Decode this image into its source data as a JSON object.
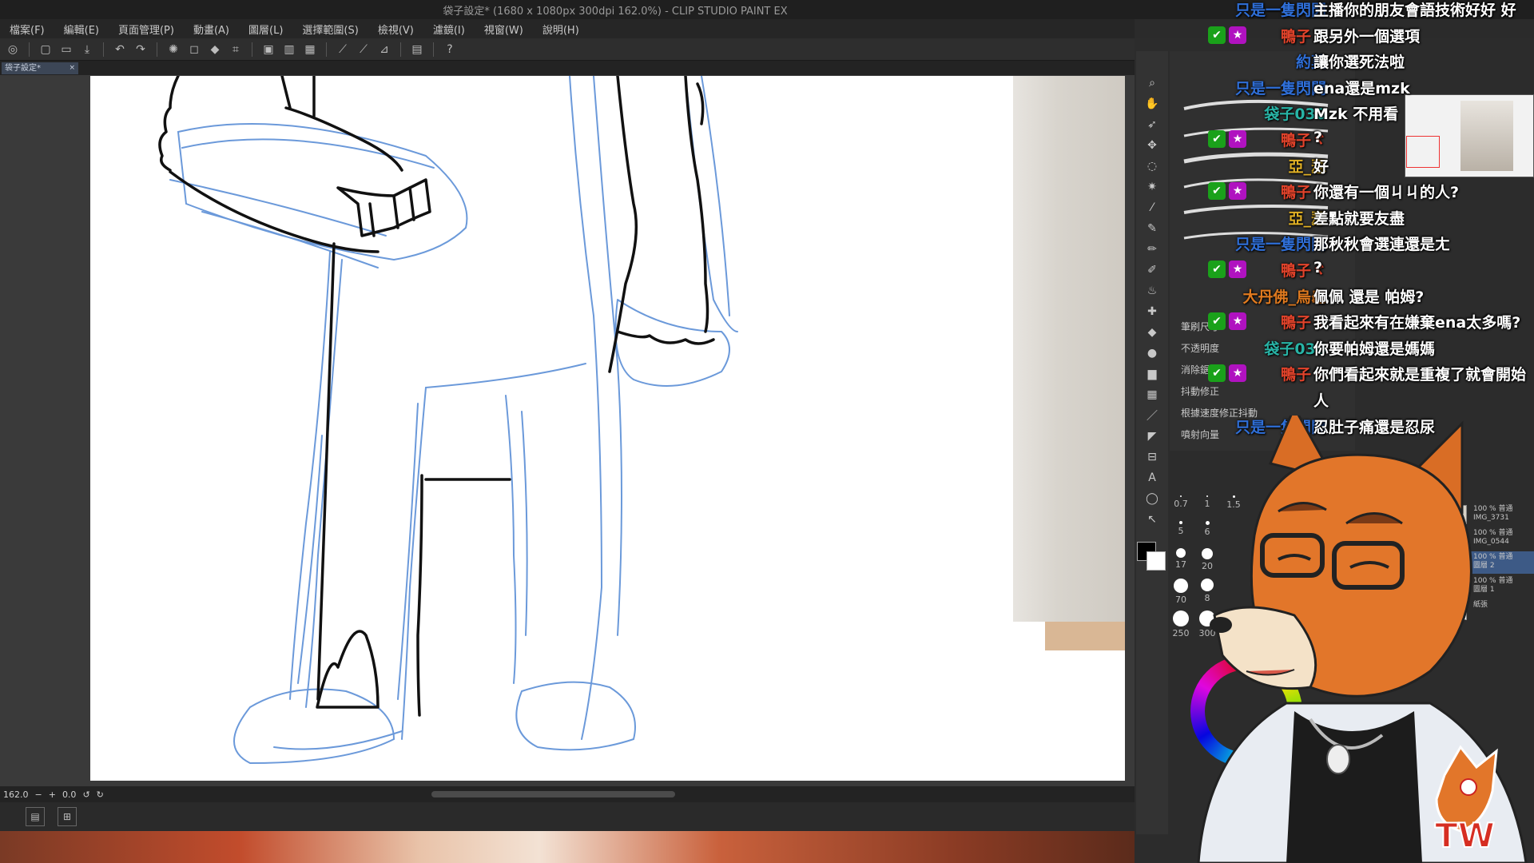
{
  "window": {
    "title": "袋子設定* (1680 x 1080px 300dpi 162.0%) - CLIP STUDIO PAINT EX"
  },
  "menu": [
    "檔案(F)",
    "編輯(E)",
    "頁面管理(P)",
    "動畫(A)",
    "圖層(L)",
    "選擇範圍(S)",
    "檢視(V)",
    "濾鏡(I)",
    "視窗(W)",
    "說明(H)"
  ],
  "doc_tab": {
    "label": "袋子設定*",
    "close": "×"
  },
  "status": {
    "zoom": "162.0",
    "angle": "0.0"
  },
  "properties": {
    "labels": [
      "筆刷尺寸",
      "不透明度",
      "消除鋸齒",
      "抖動修正",
      "根據速度修正抖動",
      "噴射向量"
    ],
    "zoom_small": "162.0"
  },
  "brush_sizes": [
    "0.7",
    "1",
    "1.5",
    "5",
    "6",
    "17",
    "20",
    "70",
    "8",
    "250",
    "300"
  ],
  "layers": [
    {
      "line1": "100 % 普通",
      "line2": "IMG_3731"
    },
    {
      "line1": "100 % 普通",
      "line2": "IMG_0544"
    },
    {
      "line1": "100 % 普通",
      "line2": "圖層 2"
    },
    {
      "line1": "100 % 普通",
      "line2": "圖層 1"
    },
    {
      "line1": "",
      "line2": "紙張"
    }
  ],
  "colors": {
    "mod_badge": "#1aa11a",
    "vip_badge": "#b012c0",
    "sketch_blue": "#5b8fd6",
    "ink": "#111111",
    "user_red": "#e2432b",
    "user_yellow": "#e0b025",
    "user_blue": "#2f6fd8",
    "user_teal": "#28b4a6",
    "user_orange": "#e07a1f"
  },
  "chat": [
    {
      "user": "只是一隻閃閃",
      "color": "#2f6fd8",
      "badges": [],
      "text": "主播你的朋友會語技術好好 好"
    },
    {
      "user": "鴨子ヾ",
      "color": "#e2432b",
      "badges": [
        "mod",
        "vip"
      ],
      "text": "跟另外一個選項"
    },
    {
      "user": "約莫",
      "color": "#2f6fd8",
      "badges": [],
      "text": "讓你選死法啦"
    },
    {
      "user": "只是一隻閃閃",
      "color": "#2f6fd8",
      "badges": [],
      "text": "ena還是mzk"
    },
    {
      "user": "袋子030",
      "color": "#28b4a6",
      "badges": [],
      "text": "Mzk 不用看"
    },
    {
      "user": "鴨子ヾ",
      "color": "#e2432b",
      "badges": [
        "mod",
        "vip"
      ],
      "text": "?"
    },
    {
      "user": "亞_瑟",
      "color": "#e0b025",
      "badges": [],
      "text": "好"
    },
    {
      "user": "鴨子ヾ",
      "color": "#e2432b",
      "badges": [
        "mod",
        "vip"
      ],
      "text": "你還有一個ㄐㄐ的人?"
    },
    {
      "user": "亞_瑟",
      "color": "#e0b025",
      "badges": [],
      "text": "差點就要友盡"
    },
    {
      "user": "只是一隻閃閃",
      "color": "#2f6fd8",
      "badges": [],
      "text": "那秋秋會選連還是ㄤ"
    },
    {
      "user": "鴨子ヾ",
      "color": "#e2432b",
      "badges": [
        "mod",
        "vip"
      ],
      "text": "?"
    },
    {
      "user": "大丹佛_烏龜",
      "color": "#e07a1f",
      "badges": [],
      "text": "佩佩 還是 帕姆?"
    },
    {
      "user": "鴨子ヾ",
      "color": "#e2432b",
      "badges": [
        "mod",
        "vip"
      ],
      "text": "我看起來有在嫌棄ena太多嗎?"
    },
    {
      "user": "袋子030",
      "color": "#28b4a6",
      "badges": [],
      "text": "你要帕姆還是媽媽"
    },
    {
      "user": "鴨子ヾ",
      "color": "#e2432b",
      "badges": [
        "mod",
        "vip"
      ],
      "text": "你們看起來就是重複了就會開始"
    },
    {
      "user": "",
      "color": "#ffffff",
      "badges": [],
      "text": "人"
    },
    {
      "user": "只是一隻閃閃",
      "color": "#2f6fd8",
      "badges": [],
      "text": "忍肚子痛還是忍尿"
    }
  ],
  "logo": {
    "text": "TW"
  }
}
